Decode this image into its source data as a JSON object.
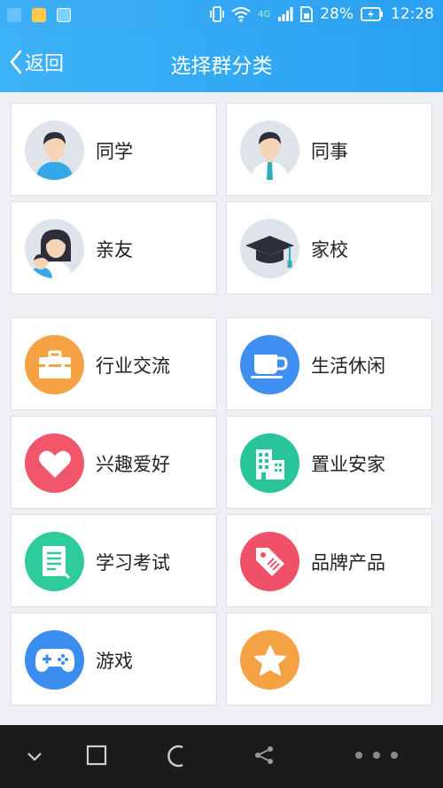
{
  "status_bar": {
    "battery": "28%",
    "time": "12:28",
    "network": "4G"
  },
  "nav": {
    "back_label": "返回",
    "title": "选择群分类"
  },
  "categories": [
    {
      "label": "同学",
      "icon": "student-avatar-icon",
      "bg": "#dfe4ea"
    },
    {
      "label": "同事",
      "icon": "colleague-avatar-icon",
      "bg": "#dfe4ea"
    },
    {
      "label": "亲友",
      "icon": "family-avatar-icon",
      "bg": "#dfe4ea"
    },
    {
      "label": "家校",
      "icon": "graduation-cap-icon",
      "bg": "#dfe4ea"
    },
    {
      "label": "行业交流",
      "icon": "briefcase-icon",
      "bg": "#f5a244"
    },
    {
      "label": "生活休闲",
      "icon": "coffee-cup-icon",
      "bg": "#3f8ff0"
    },
    {
      "label": "兴趣爱好",
      "icon": "heart-icon",
      "bg": "#f1566a"
    },
    {
      "label": "置业安家",
      "icon": "buildings-icon",
      "bg": "#28c49a"
    },
    {
      "label": "学习考试",
      "icon": "notebook-icon",
      "bg": "#2fcc9b"
    },
    {
      "label": "品牌产品",
      "icon": "tag-icon",
      "bg": "#f05169"
    },
    {
      "label": "游戏",
      "icon": "gamepad-icon",
      "bg": "#3b8def"
    },
    {
      "label": "",
      "icon": "star-icon",
      "bg": "#f5a244"
    }
  ],
  "bottom_nav": [
    "chevron-down-icon",
    "recents-square-icon",
    "home-circle-icon",
    "share-icon",
    "more-icon"
  ]
}
